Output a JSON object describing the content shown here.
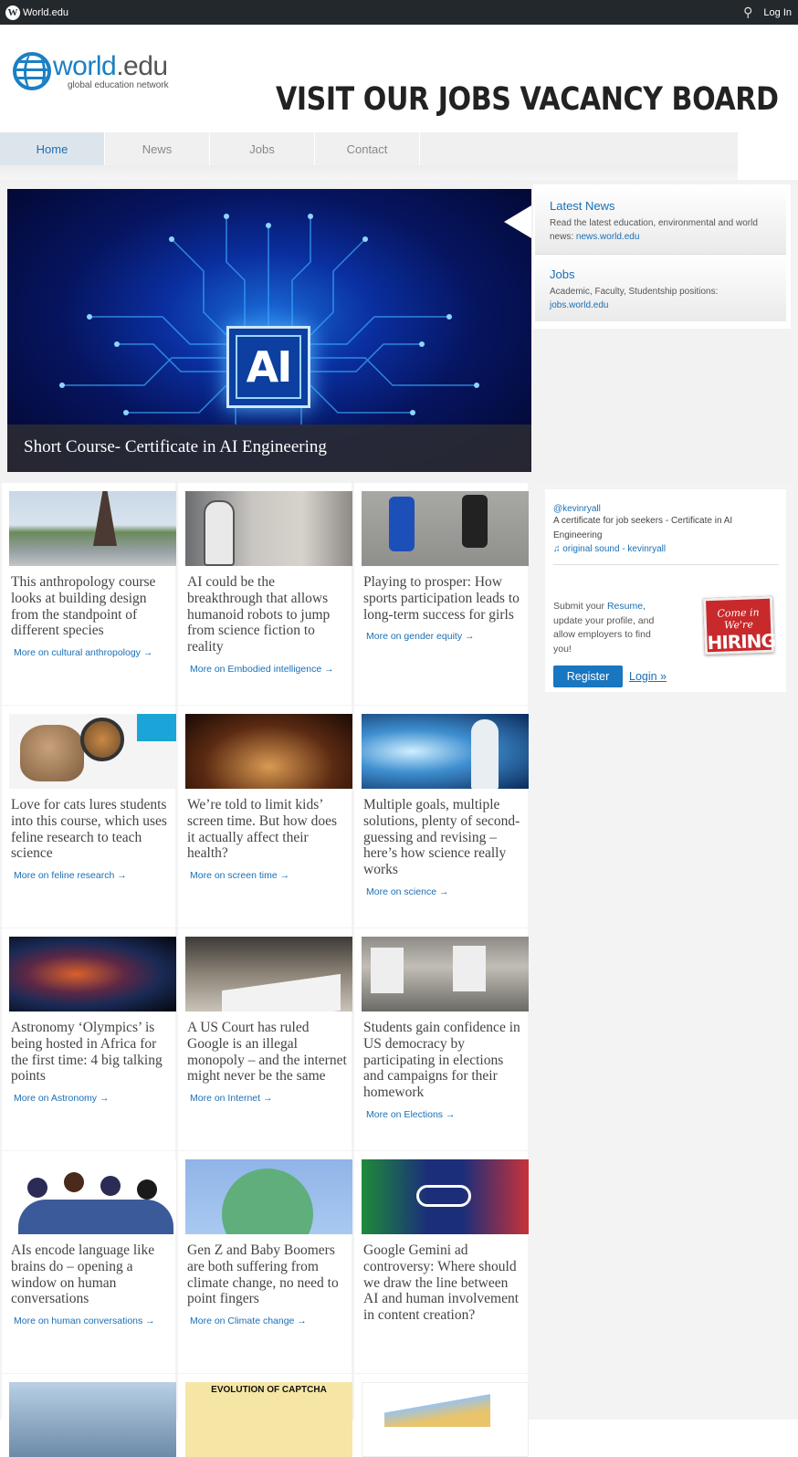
{
  "topbar": {
    "site": "World.edu",
    "login": "Log In"
  },
  "logo": {
    "main": "world",
    "edu": ".edu",
    "sub": "global education network"
  },
  "banner": "VISIT OUR JOBS VACANCY BOARD",
  "nav": [
    "Home",
    "News",
    "Jobs",
    "Contact"
  ],
  "hero": {
    "chip_text": "AI",
    "caption": "Short Course- Certificate in AI Engineering"
  },
  "side": {
    "news_title": "Latest News",
    "news_text": "Read the latest education, environmental and world news: ",
    "news_link": "news.world.edu",
    "jobs_title": "Jobs",
    "jobs_text": "Academic, Faculty, Studentship positions: ",
    "jobs_link": "jobs.world.edu"
  },
  "cards": [
    {
      "title": "This anthropology course looks at building design from the standpoint of different species",
      "link": "More on cultural anthropology →"
    },
    {
      "title": "AI could be the breakthrough that allows humanoid robots to jump from science fiction to reality",
      "link": "More on Embodied intelligence →"
    },
    {
      "title": "Playing to prosper: How sports participation leads to long-term success for girls",
      "link": "More on gender equity →"
    },
    {
      "title": "Love for cats lures students into this course, which uses feline research to teach science",
      "link": "More on feline research →"
    },
    {
      "title": "We’re told to limit kids’ screen time. But how does it actually affect their health?",
      "link": "More on screen time →"
    },
    {
      "title": "Multiple goals, multiple solutions, plenty of second-guessing and revising – here’s how science really works",
      "link": "More on science →"
    },
    {
      "title": "Astronomy ‘Olympics’ is being hosted in Africa for the first time: 4 big talking points",
      "link": "More on Astronomy →"
    },
    {
      "title": "A US Court has ruled Google is an illegal monopoly – and the internet might never be the same",
      "link": "More on Internet →"
    },
    {
      "title": "Students gain confidence in US democracy by participating in elections and campaigns for their homework",
      "link": "More on Elections →"
    },
    {
      "title": "AIs encode language like brains do – opening a window on human conversations",
      "link": "More on human conversations →"
    },
    {
      "title": "Gen Z and Baby Boomers are both suffering from climate change, no need to point fingers",
      "link": "More on Climate change →"
    },
    {
      "title": "Google Gemini ad controversy: Where should we draw the line between AI and human involvement in content creation?",
      "link": ""
    }
  ],
  "thumb_texts": {
    "captcha": "EVOLUTION OF CAPTCHA"
  },
  "widget": {
    "user": "@kevinryall",
    "text": "A certificate for job seekers - Certificate in AI Engineering",
    "sound": "♫ original sound - kevinryall",
    "resume_pre": "Submit your ",
    "resume_link": "Resume",
    "resume_post": ", update your profile, and allow employers to find you!",
    "hire_top": "Come in We're",
    "hire_main": "HIRING",
    "register": "Register",
    "login": "Login »"
  },
  "colors": {
    "accent": "#1a6fb5",
    "topbar": "#23282d",
    "button": "#1976c0",
    "hiring": "#c8292b"
  }
}
